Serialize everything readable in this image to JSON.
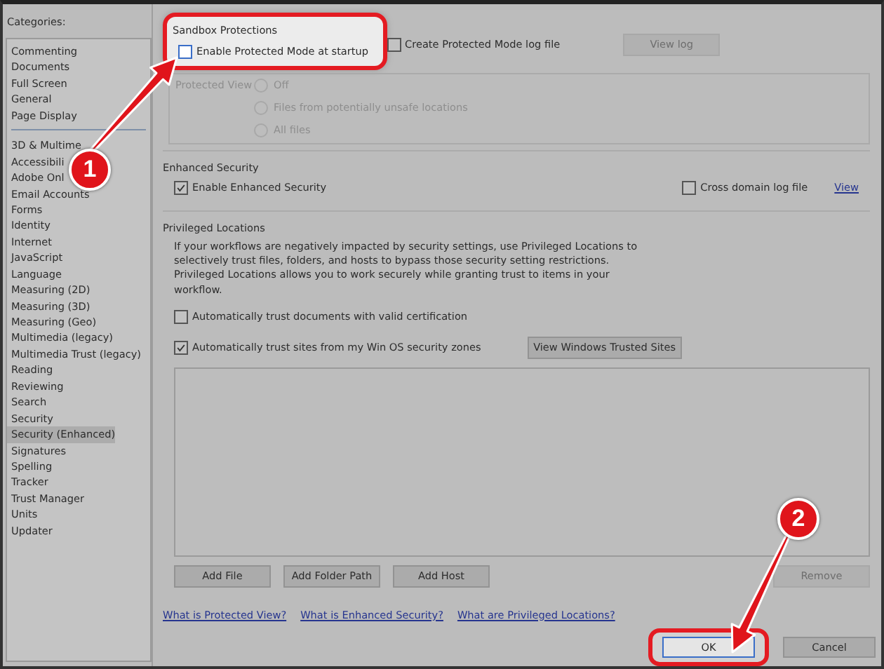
{
  "sidebar": {
    "label": "Categories:",
    "groups": [
      {
        "items": [
          {
            "label": "Commenting",
            "selected": false
          },
          {
            "label": "Documents",
            "selected": false
          },
          {
            "label": "Full Screen",
            "selected": false
          },
          {
            "label": "General",
            "selected": false
          },
          {
            "label": "Page Display",
            "selected": false
          }
        ]
      },
      {
        "items": [
          {
            "label": "3D & Multime",
            "selected": false
          },
          {
            "label": "Accessibili",
            "selected": false
          },
          {
            "label": "Adobe Onl",
            "selected": false
          },
          {
            "label": "Email Accounts",
            "selected": false
          },
          {
            "label": "Forms",
            "selected": false
          },
          {
            "label": "Identity",
            "selected": false
          },
          {
            "label": "Internet",
            "selected": false
          },
          {
            "label": "JavaScript",
            "selected": false
          },
          {
            "label": "Language",
            "selected": false
          },
          {
            "label": "Measuring (2D)",
            "selected": false
          },
          {
            "label": "Measuring (3D)",
            "selected": false
          },
          {
            "label": "Measuring (Geo)",
            "selected": false
          },
          {
            "label": "Multimedia (legacy)",
            "selected": false
          },
          {
            "label": "Multimedia Trust (legacy)",
            "selected": false
          },
          {
            "label": "Reading",
            "selected": false
          },
          {
            "label": "Reviewing",
            "selected": false
          },
          {
            "label": "Search",
            "selected": false
          },
          {
            "label": "Security",
            "selected": false
          },
          {
            "label": "Security (Enhanced)",
            "selected": true
          },
          {
            "label": "Signatures",
            "selected": false
          },
          {
            "label": "Spelling",
            "selected": false
          },
          {
            "label": "Tracker",
            "selected": false
          },
          {
            "label": "Trust Manager",
            "selected": false
          },
          {
            "label": "Units",
            "selected": false
          },
          {
            "label": "Updater",
            "selected": false
          }
        ]
      }
    ]
  },
  "sandbox": {
    "title": "Sandbox Protections",
    "protected_mode": {
      "label": "Enable Protected Mode at startup",
      "checked": false
    },
    "log_file": {
      "label": "Create Protected Mode log file",
      "checked": false
    },
    "view_log": {
      "label": "View log",
      "disabled": true
    },
    "protected_view": {
      "label": "Protected View",
      "options": [
        {
          "label": "Off",
          "selected": false
        },
        {
          "label": "Files from potentially unsafe locations",
          "selected": false
        },
        {
          "label": "All files",
          "selected": false
        }
      ]
    }
  },
  "enhanced": {
    "title": "Enhanced Security",
    "enable": {
      "label": "Enable Enhanced Security",
      "checked": true
    },
    "cross_domain": {
      "label": "Cross domain log file",
      "checked": false
    },
    "view_link": "View"
  },
  "privileged": {
    "title": "Privileged Locations",
    "description": "If your workflows are negatively impacted by security settings, use Privileged Locations to selectively trust files, folders, and hosts to bypass those security setting restrictions. Privileged Locations allows you to work securely while granting trust to items in your workflow.",
    "options": [
      {
        "label": "Automatically trust documents with valid certification",
        "checked": false
      },
      {
        "label": "Automatically trust sites from my Win OS security zones",
        "checked": true
      }
    ],
    "trusted_sites_button": "View Windows Trusted Sites",
    "buttons": [
      {
        "label": "Add File",
        "disabled": false
      },
      {
        "label": "Add Folder Path",
        "disabled": false
      },
      {
        "label": "Add Host",
        "disabled": false
      },
      {
        "label": "Remove",
        "disabled": true
      }
    ]
  },
  "links": [
    "What is Protected View?",
    "What is Enhanced Security?",
    "What are Privileged Locations?"
  ],
  "footer_buttons": [
    {
      "label": "OK",
      "default": true
    },
    {
      "label": "Cancel",
      "default": false
    }
  ],
  "callouts": [
    {
      "number": "1"
    },
    {
      "number": "2"
    }
  ]
}
